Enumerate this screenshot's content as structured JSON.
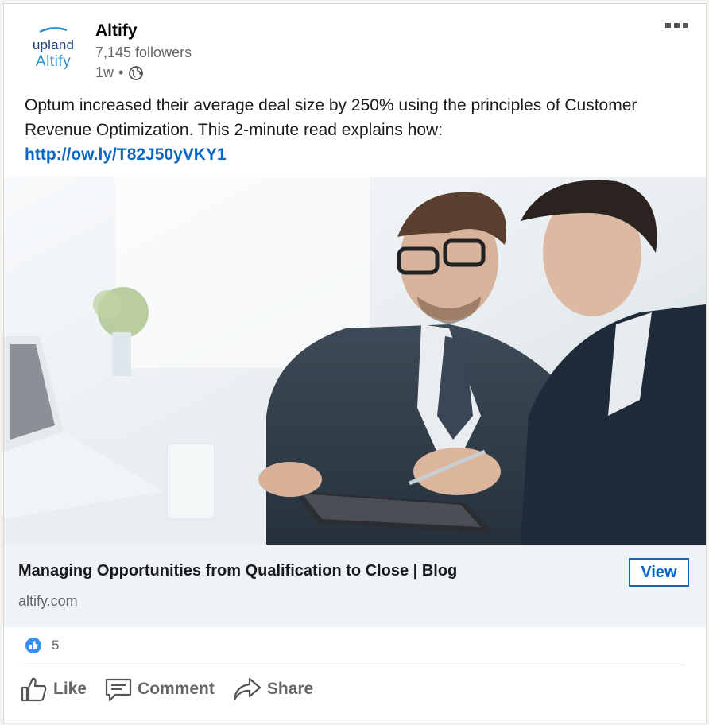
{
  "post": {
    "company": "Altify",
    "followers": "7,145 followers",
    "age": "1w",
    "separator": "•",
    "text": "Optum increased their average deal size by 250% using the principles of Customer Revenue Optimization. This 2-minute read explains how:",
    "link_text": "http://ow.ly/T82J50yVKY1"
  },
  "logo": {
    "top": "upland",
    "bottom": "Altify"
  },
  "link_preview": {
    "title": "Managing Opportunities from Qualification to Close | Blog",
    "domain": "altify.com",
    "view_label": "View"
  },
  "social": {
    "reaction_count": "5",
    "actions": {
      "like": "Like",
      "comment": "Comment",
      "share": "Share"
    }
  },
  "icons": {
    "menu": "more-icon",
    "visibility": "globe-icon",
    "reaction": "like-reaction-icon",
    "like": "thumbs-up-icon",
    "comment": "comment-icon",
    "share": "share-arrow-icon"
  },
  "colors": {
    "link": "#0a66c2",
    "secondary_text": "#666666",
    "preview_bg": "#eef3f8"
  }
}
